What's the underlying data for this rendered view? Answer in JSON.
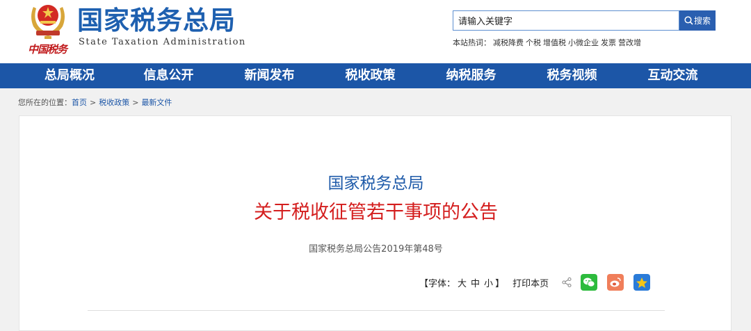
{
  "header": {
    "handwriting": "中国税务",
    "title": "国家税务总局",
    "subtitle": "State Taxation Administration"
  },
  "search": {
    "value": "请输入关键字",
    "button_label": "搜索"
  },
  "hotwords": {
    "label": "本站热词：",
    "items": [
      "减税降费",
      "个税",
      "增值税",
      "小微企业",
      "发票",
      "营改增"
    ]
  },
  "nav": {
    "items": [
      "总局概况",
      "信息公开",
      "新闻发布",
      "税收政策",
      "纳税服务",
      "税务视频",
      "互动交流"
    ]
  },
  "breadcrumb": {
    "prefix": "您所在的位置：",
    "items": [
      "首页",
      "税收政策",
      "最新文件"
    ],
    "separator": ">"
  },
  "article": {
    "issuer": "国家税务总局",
    "title": "关于税收征管若干事项的公告",
    "number": "国家税务总局公告2019年第48号"
  },
  "tools": {
    "font_open": "【字体：",
    "font_large": "大",
    "font_medium": "中",
    "font_small": "小",
    "font_close": "】",
    "print": "打印本页"
  },
  "colors": {
    "brand_blue": "#1c56a7",
    "title_red": "#d41e1e"
  }
}
